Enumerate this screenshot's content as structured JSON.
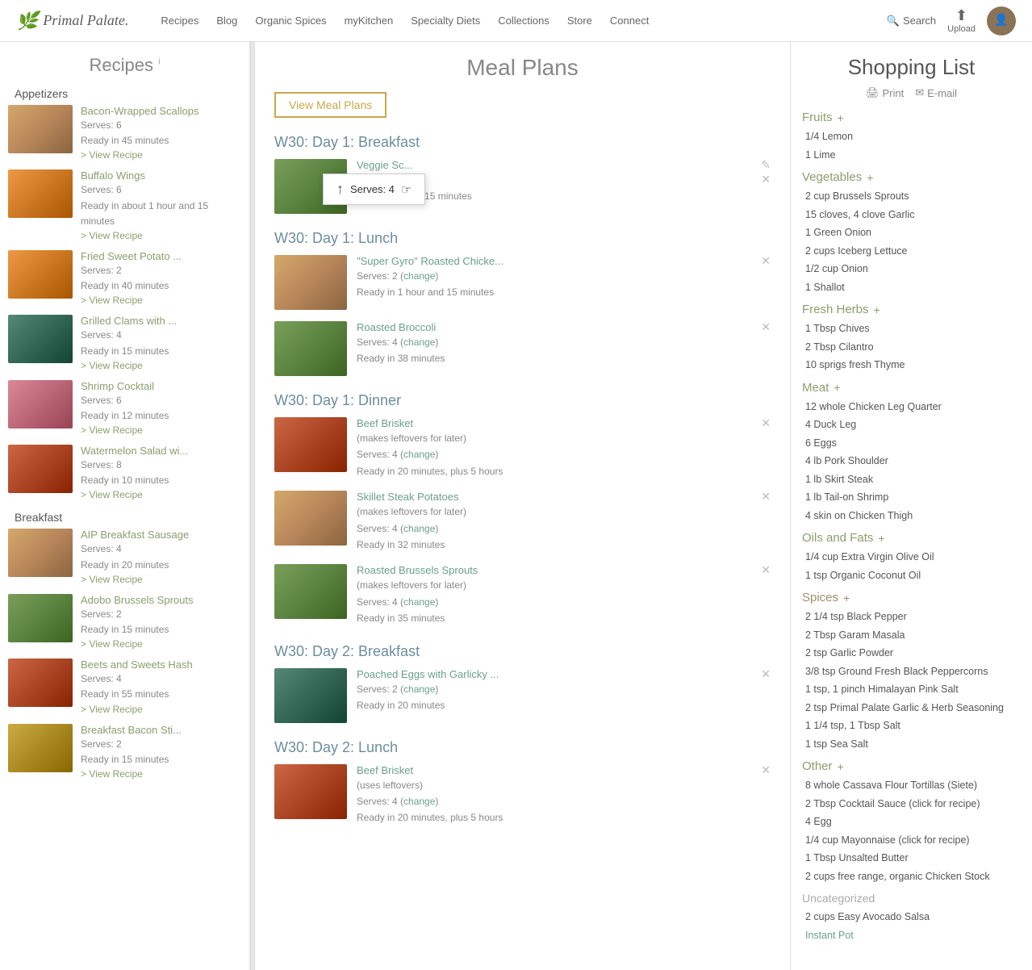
{
  "nav": {
    "logo_text": "Primal Palate.",
    "links": [
      "Recipes",
      "Blog",
      "Organic Spices",
      "myKitchen",
      "Specialty Diets",
      "Collections",
      "Store",
      "Connect"
    ],
    "search_label": "Search",
    "upload_label": "Upload"
  },
  "sidebar": {
    "title": "Recipes",
    "title_info": "i",
    "categories": [
      {
        "label": "Appetizers",
        "recipes": [
          {
            "name": "Bacon-Wrapped Scallops",
            "serves": "Serves: 6",
            "ready": "Ready in 45 minutes",
            "thumb_class": "thumb-brown"
          },
          {
            "name": "Buffalo Wings",
            "serves": "Serves: 6",
            "ready": "Ready in about 1 hour and 15 minutes",
            "thumb_class": "thumb-orange"
          },
          {
            "name": "Fried Sweet Potato ...",
            "serves": "Serves: 2",
            "ready": "Ready in 40 minutes",
            "thumb_class": "thumb-orange"
          },
          {
            "name": "Grilled Clams with ...",
            "serves": "Serves: 4",
            "ready": "Ready in 15 minutes",
            "thumb_class": "thumb-teal"
          },
          {
            "name": "Shrimp Cocktail",
            "serves": "Serves: 6",
            "ready": "Ready in 12 minutes",
            "thumb_class": "thumb-pink"
          },
          {
            "name": "Watermelon Salad wi...",
            "serves": "Serves: 8",
            "ready": "Ready in 10 minutes",
            "thumb_class": "thumb-red"
          }
        ]
      },
      {
        "label": "Breakfast",
        "recipes": [
          {
            "name": "AIP Breakfast Sausage",
            "serves": "Serves: 4",
            "ready": "Ready in 20 minutes",
            "thumb_class": "thumb-brown"
          },
          {
            "name": "Adobo Brussels Sprouts",
            "serves": "Serves: 2",
            "ready": "Ready in 15 minutes",
            "thumb_class": "thumb-green"
          },
          {
            "name": "Beets and Sweets Hash",
            "serves": "Serves: 4",
            "ready": "Ready in 55 minutes",
            "thumb_class": "thumb-red"
          },
          {
            "name": "Breakfast Bacon Sti...",
            "serves": "Serves: 2",
            "ready": "Ready in 15 minutes",
            "thumb_class": "thumb-yellow"
          }
        ]
      }
    ]
  },
  "center": {
    "title": "Meal Plans",
    "view_btn": "View Meal Plans",
    "tooltip_text": "Serves: 4",
    "sections": [
      {
        "title": "W30: Day 1: Breakfast",
        "meals": [
          {
            "name": "Veggie Sc...",
            "serves": "Serves: 4",
            "ready": "Ready in about 15 minutes",
            "thumb_class": "thumb-green",
            "show_tooltip": true
          }
        ]
      },
      {
        "title": "W30: Day 1: Lunch",
        "meals": [
          {
            "name": "\"Super Gyro\" Roasted Chicke...",
            "serves": "Serves: 2 (change)",
            "ready": "Ready in 1 hour and 15 minutes",
            "thumb_class": "thumb-brown",
            "show_tooltip": false
          },
          {
            "name": "Roasted Broccoli",
            "serves": "Serves: 4 (change)",
            "ready": "Ready in 38 minutes",
            "thumb_class": "thumb-green",
            "show_tooltip": false
          }
        ]
      },
      {
        "title": "W30: Day 1: Dinner",
        "meals": [
          {
            "name": "Beef Brisket",
            "serves": "Serves: 4 (change)",
            "ready": "Ready in 20 minutes, plus 5 hours",
            "note": "(makes leftovers for later)",
            "thumb_class": "thumb-red",
            "show_tooltip": false
          },
          {
            "name": "Skillet Steak Potatoes",
            "serves": "Serves: 4 (change)",
            "ready": "Ready in 32 minutes",
            "note": "(makes leftovers for later)",
            "thumb_class": "thumb-brown",
            "show_tooltip": false
          },
          {
            "name": "Roasted Brussels Sprouts",
            "serves": "Serves: 4 (change)",
            "ready": "Ready in 35 minutes",
            "note": "(makes leftovers for later)",
            "thumb_class": "thumb-green",
            "show_tooltip": false
          }
        ]
      },
      {
        "title": "W30: Day 2: Breakfast",
        "meals": [
          {
            "name": "Poached Eggs with Garlicky ...",
            "serves": "Serves: 2 (change)",
            "ready": "Ready in 20 minutes",
            "thumb_class": "thumb-teal",
            "show_tooltip": false
          }
        ]
      },
      {
        "title": "W30: Day 2: Lunch",
        "meals": [
          {
            "name": "Beef Brisket",
            "serves": "Serves: 4 (change)",
            "ready": "Ready in 20 minutes, plus 5 hours",
            "note": "(uses leftovers)",
            "thumb_class": "thumb-red",
            "show_tooltip": false
          }
        ]
      }
    ]
  },
  "shopping": {
    "title": "Shopping List",
    "print_label": "Print",
    "email_label": "E-mail",
    "categories": [
      {
        "name": "Fruits",
        "color": "fruits",
        "items": [
          "1/4 Lemon",
          "1 Lime"
        ]
      },
      {
        "name": "Vegetables",
        "color": "veg",
        "items": [
          "2 cup Brussels Sprouts",
          "15 cloves, 4 clove Garlic",
          "1 Green Onion",
          "2 cups Iceberg Lettuce",
          "1/2 cup Onion",
          "1 Shallot"
        ]
      },
      {
        "name": "Fresh Herbs",
        "color": "herbs",
        "items": [
          "1 Tbsp Chives",
          "2 Tbsp Cilantro",
          "10 sprigs fresh Thyme"
        ]
      },
      {
        "name": "Meat",
        "color": "meat",
        "items": [
          "12 whole Chicken Leg Quarter",
          "4 Duck Leg",
          "6 Eggs",
          "4 lb Pork Shoulder",
          "1 lb Skirt Steak",
          "1 lb Tail-on Shrimp",
          "4 skin on Chicken Thigh"
        ]
      },
      {
        "name": "Oils and Fats",
        "color": "oils",
        "items": [
          "1/4 cup Extra Virgin Olive Oil",
          "1 tsp Organic Coconut Oil"
        ]
      },
      {
        "name": "Spices",
        "color": "spices",
        "items": [
          "2 1/4 tsp Black Pepper",
          "2 Tbsp Garam Masala",
          "2 tsp Garlic Powder",
          "3/8 tsp Ground Fresh Black Peppercorns",
          "1 tsp, 1 pinch Himalayan Pink Salt",
          "2 tsp Primal Palate Garlic & Herb Seasoning",
          "1 1/4 tsp, 1 Tbsp Salt",
          "1 tsp Sea Salt"
        ]
      },
      {
        "name": "Other",
        "color": "other",
        "items": [
          "8 whole Cassava Flour Tortillas (Siete)",
          "2 Tbsp Cocktail Sauce (click for recipe)",
          "4 Egg",
          "1/4 cup Mayonnaise (click for recipe)",
          "1 Tbsp Unsalted Butter",
          "2 cups free range, organic Chicken Stock"
        ]
      },
      {
        "name": "Uncategorized",
        "color": "uncat",
        "items": [
          "2 cups Easy Avocado Salsa",
          "Instant Pot"
        ]
      }
    ]
  }
}
